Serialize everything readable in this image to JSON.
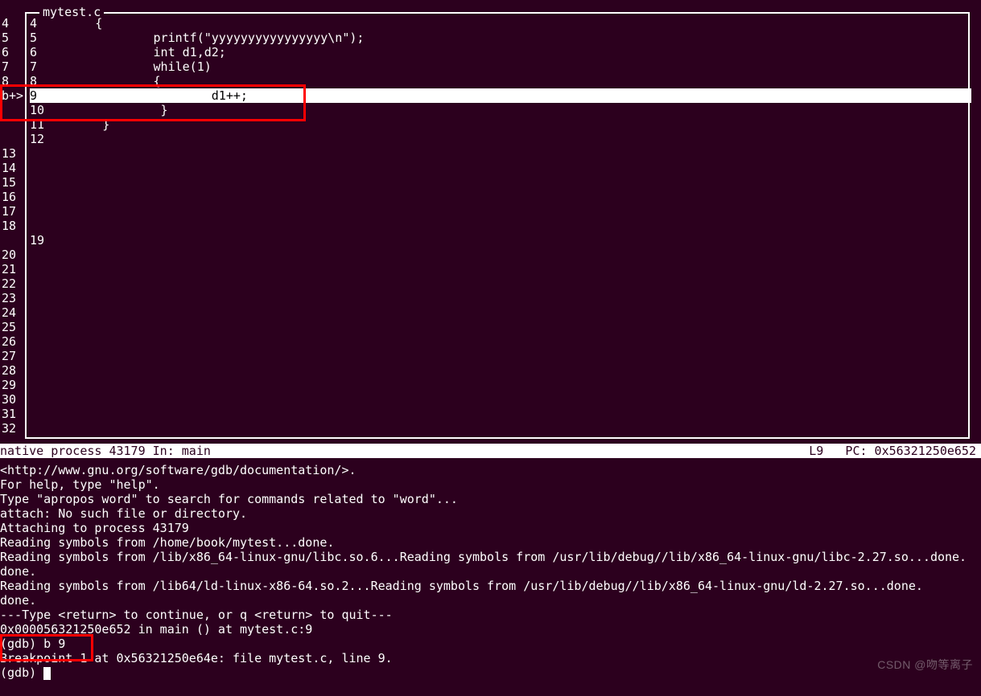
{
  "source": {
    "filename": "mytest.c",
    "breakpoint_marker": "b+>",
    "lines": [
      {
        "num": "4",
        "text": "        {",
        "hl": false
      },
      {
        "num": "5",
        "text": "                printf(\"yyyyyyyyyyyyyyyy\\n\");",
        "hl": false
      },
      {
        "num": "6",
        "text": "                int d1,d2;",
        "hl": false
      },
      {
        "num": "7",
        "text": "                while(1)",
        "hl": false
      },
      {
        "num": "8",
        "text": "                {",
        "hl": false
      },
      {
        "num": "9",
        "text": "                        d1++;",
        "hl": true
      },
      {
        "num": "10",
        "text": "                }",
        "hl": false
      },
      {
        "num": "11",
        "text": "        }",
        "hl": false
      },
      {
        "num": "12",
        "text": "",
        "hl": false
      }
    ],
    "blank_line_num": "19"
  },
  "gutter_below": [
    "13",
    "14",
    "15",
    "16",
    "17",
    "18",
    "",
    "",
    "20",
    "21",
    "22",
    "23",
    "24",
    "25",
    "26",
    "27",
    "28",
    "29",
    "30",
    "31",
    "32"
  ],
  "status": {
    "left": "native process 43179 In: main",
    "right": "L9   PC: 0x56321250e652"
  },
  "console": [
    "<http://www.gnu.org/software/gdb/documentation/>.",
    "For help, type \"help\".",
    "Type \"apropos word\" to search for commands related to \"word\"...",
    "attach: No such file or directory.",
    "Attaching to process 43179",
    "Reading symbols from /home/book/mytest...done.",
    "Reading symbols from /lib/x86_64-linux-gnu/libc.so.6...Reading symbols from /usr/lib/debug//lib/x86_64-linux-gnu/libc-2.27.so...done.",
    "done.",
    "Reading symbols from /lib64/ld-linux-x86-64.so.2...Reading symbols from /usr/lib/debug//lib/x86_64-linux-gnu/ld-2.27.so...done.",
    "done.",
    "---Type <return> to continue, or q <return> to quit---",
    "0x000056321250e652 in main () at mytest.c:9",
    "(gdb) b 9",
    "Breakpoint 1 at 0x56321250e64e: file mytest.c, line 9.",
    "(gdb) "
  ],
  "watermark": "CSDN @吻等离子"
}
